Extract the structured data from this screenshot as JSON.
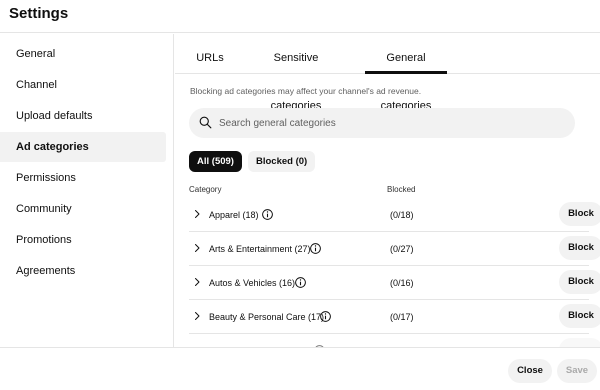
{
  "header": {
    "title": "Settings"
  },
  "sidebar": {
    "items": [
      {
        "label": "General"
      },
      {
        "label": "Channel"
      },
      {
        "label": "Upload defaults"
      },
      {
        "label": "Ad categories"
      },
      {
        "label": "Permissions"
      },
      {
        "label": "Community"
      },
      {
        "label": "Promotions"
      },
      {
        "label": "Agreements"
      }
    ],
    "active_label": "Ad categories"
  },
  "tabs": [
    {
      "label": "URLs"
    },
    {
      "label": "Sensitive categories"
    },
    {
      "label": "General categories"
    }
  ],
  "active_tab": "General categories",
  "note": "Blocking ad categories may affect your channel's ad revenue.",
  "search": {
    "placeholder": "Search general categories",
    "value": ""
  },
  "filters": {
    "all": "All (509)",
    "blocked": "Blocked (0)",
    "selected": "All (509)"
  },
  "table": {
    "headers": {
      "category": "Category",
      "blocked": "Blocked"
    },
    "rows": [
      {
        "name": "Apparel (18)",
        "count": "(0/18)",
        "action": "Block"
      },
      {
        "name": "Arts & Entertainment (27)",
        "count": "(0/27)",
        "action": "Block"
      },
      {
        "name": "Autos & Vehicles (16)",
        "count": "(0/16)",
        "action": "Block"
      },
      {
        "name": "Beauty & Personal Care (17)",
        "count": "(0/17)",
        "action": "Block"
      }
    ]
  },
  "footer": {
    "close_label": "Close",
    "save_label": "Save"
  },
  "colors": {
    "text": "#0f0f0f",
    "secondary": "#606060",
    "chip_bg": "#f2f2f2",
    "selected_chip_bg": "#0f0f0f",
    "divider": "#e5e5e5"
  },
  "icons": {
    "search": "search-icon",
    "chevron": "chevron-right-icon",
    "info": "info-icon"
  }
}
